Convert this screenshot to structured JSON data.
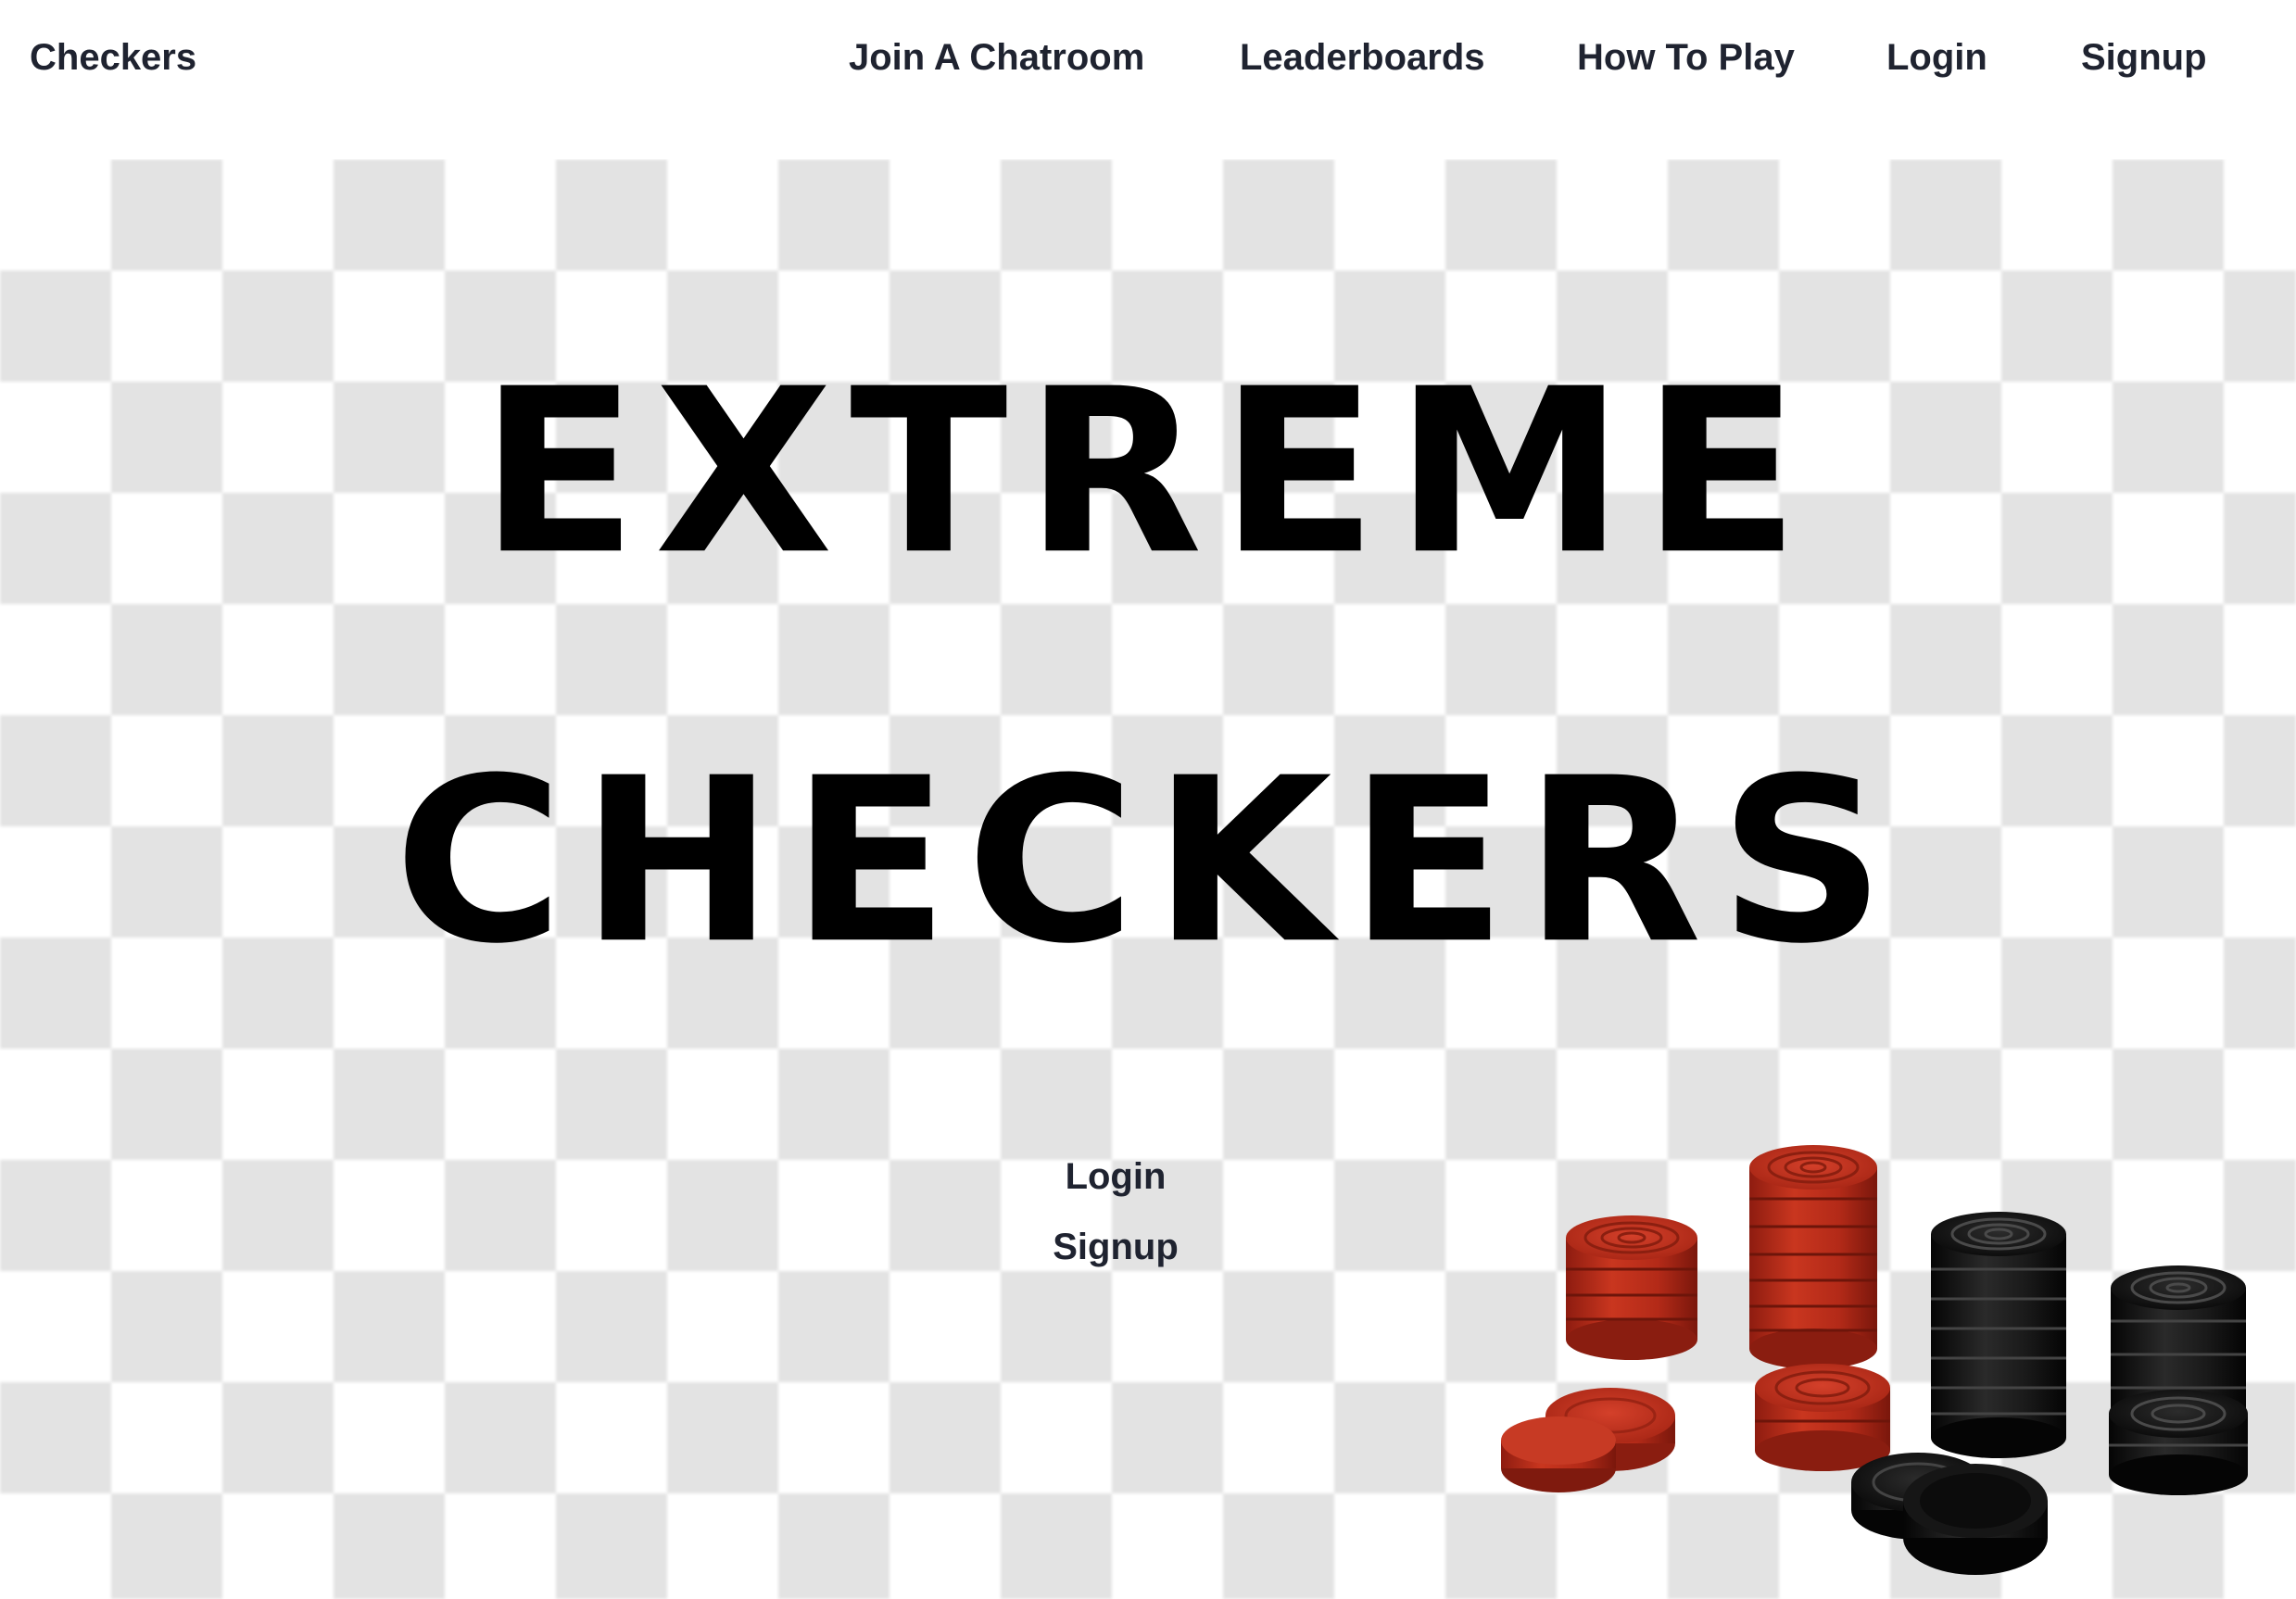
{
  "app": {
    "brand": "Checkers"
  },
  "nav": {
    "items": [
      {
        "label": "Join A Chatroom"
      },
      {
        "label": "Leaderboards"
      },
      {
        "label": "How To Play"
      },
      {
        "label": "Login"
      },
      {
        "label": "Signup"
      }
    ]
  },
  "hero": {
    "line1": "EXTREME",
    "line2": "CHECKERS"
  },
  "actions": {
    "login_label": "Login",
    "signup_label": "Signup"
  },
  "colors": {
    "text": "#1f2330",
    "title": "#000000",
    "board_light": "#ffffff",
    "board_dark": "#e3e3e3",
    "piece_red": "#c0301c",
    "piece_black": "#141414"
  },
  "illustration": {
    "icon": "checker-pieces-icon"
  }
}
